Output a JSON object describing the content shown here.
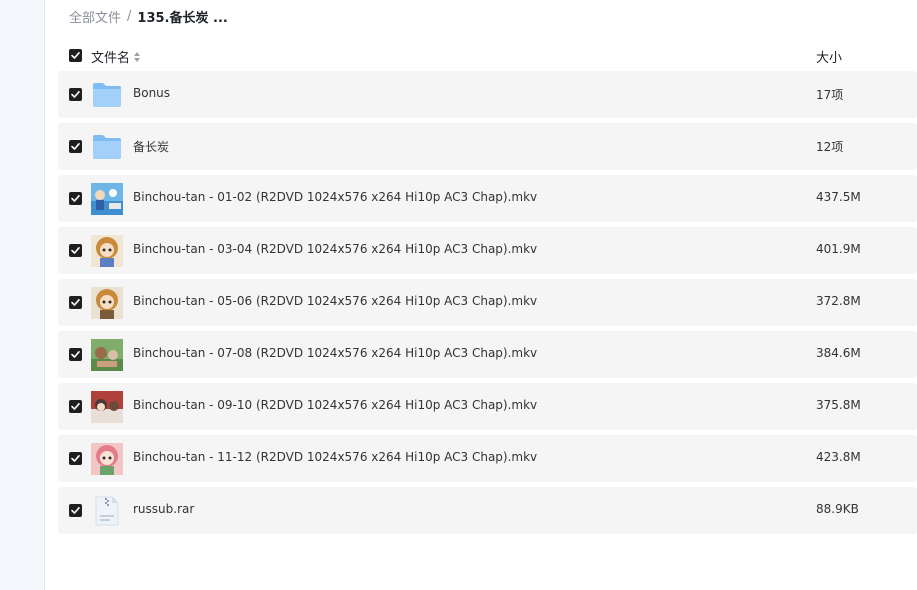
{
  "breadcrumb": {
    "root": "全部文件",
    "separator": "/",
    "current": "135.备长炭 ..."
  },
  "list_header": {
    "name_label": "文件名",
    "size_label": "大小",
    "sort_icon": "sort-icon"
  },
  "colors": {
    "checkbox": "#1f1f1f",
    "row_background": "#f5f5f5",
    "folder": "#8cc3f5",
    "sidebar": "#f4f6fc"
  },
  "files": [
    {
      "name": "Bonus",
      "size": "17项",
      "icon": "folder-icon",
      "checked": true
    },
    {
      "name": "备长炭",
      "size": "12项",
      "icon": "folder-icon",
      "checked": true
    },
    {
      "name": "Binchou-tan - 01-02 (R2DVD 1024x576 x264 Hi10p AC3 Chap).mkv",
      "size": "437.5M",
      "icon": "video-thumbnail-icon",
      "checked": true
    },
    {
      "name": "Binchou-tan - 03-04 (R2DVD 1024x576 x264 Hi10p AC3 Chap).mkv",
      "size": "401.9M",
      "icon": "video-thumbnail-icon",
      "checked": true
    },
    {
      "name": "Binchou-tan - 05-06 (R2DVD 1024x576 x264 Hi10p AC3 Chap).mkv",
      "size": "372.8M",
      "icon": "video-thumbnail-icon",
      "checked": true
    },
    {
      "name": "Binchou-tan - 07-08 (R2DVD 1024x576 x264 Hi10p AC3 Chap).mkv",
      "size": "384.6M",
      "icon": "video-thumbnail-icon",
      "checked": true
    },
    {
      "name": "Binchou-tan - 09-10 (R2DVD 1024x576 x264 Hi10p AC3 Chap).mkv",
      "size": "375.8M",
      "icon": "video-thumbnail-icon",
      "checked": true
    },
    {
      "name": "Binchou-tan - 11-12 (R2DVD 1024x576 x264 Hi10p AC3 Chap).mkv",
      "size": "423.8M",
      "icon": "video-thumbnail-icon",
      "checked": true
    },
    {
      "name": "russub.rar",
      "size": "88.9KB",
      "icon": "archive-icon",
      "checked": true
    }
  ]
}
